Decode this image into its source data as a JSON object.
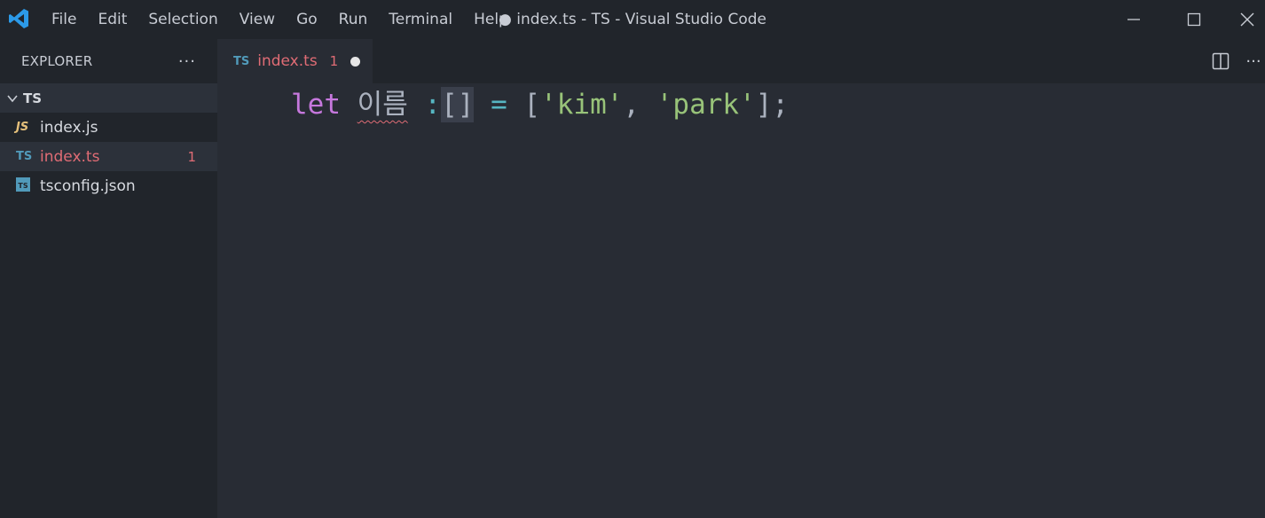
{
  "titlebar": {
    "menu": [
      "File",
      "Edit",
      "Selection",
      "View",
      "Go",
      "Run",
      "Terminal",
      "Help"
    ],
    "window_title": "● index.ts - TS - Visual Studio Code",
    "icons": [
      "vscode-logo-icon",
      "minimize-icon",
      "maximize-icon",
      "close-icon"
    ]
  },
  "sidebar": {
    "title": "EXPLORER",
    "more": "···",
    "folder": "TS",
    "files": [
      {
        "icon": "JS",
        "name": "index.js",
        "badge": ""
      },
      {
        "icon": "TS",
        "name": "index.ts",
        "badge": "1"
      },
      {
        "icon": "TS",
        "name": "tsconfig.json",
        "badge": ""
      }
    ]
  },
  "tabs": [
    {
      "icon": "TS",
      "name": "index.ts",
      "count": "1",
      "modified": true
    }
  ],
  "editor": {
    "tokens": {
      "kw": "let",
      "var": "이름",
      "colon": ":",
      "brackets": "[]",
      "eq": "=",
      "open": "[",
      "str1": "'kim'",
      "comma": ",",
      "str2": "'park'",
      "close": "];"
    }
  },
  "colors": {
    "accent": "#528bff",
    "error": "#e06c75",
    "keyword": "#c678dd",
    "string": "#98c379",
    "ts_blue": "#519aba",
    "js_yellow": "#e5c07b"
  }
}
